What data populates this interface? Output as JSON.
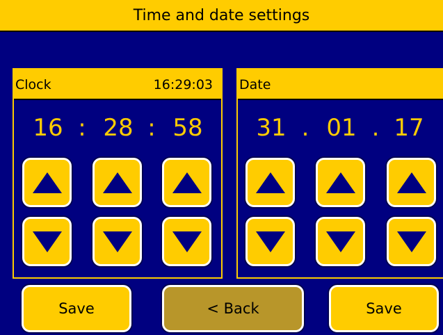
{
  "header": {
    "title": "Time and date settings"
  },
  "clock": {
    "label": "Clock",
    "current_time": "16:29:03",
    "hours": "16",
    "minutes": "28",
    "seconds": "58",
    "separator": ":"
  },
  "date": {
    "label": "Date",
    "day": "31",
    "month": "01",
    "year": "17",
    "separator": "."
  },
  "buttons": {
    "save_left": "Save",
    "back": "< Back",
    "save_right": "Save"
  },
  "colors": {
    "background": "#000080",
    "accent": "#FFCC00",
    "back_button": "#B8962A",
    "button_border": "#FFFFFF"
  },
  "icons": {
    "up": "triangle-up-icon",
    "down": "triangle-down-icon"
  }
}
